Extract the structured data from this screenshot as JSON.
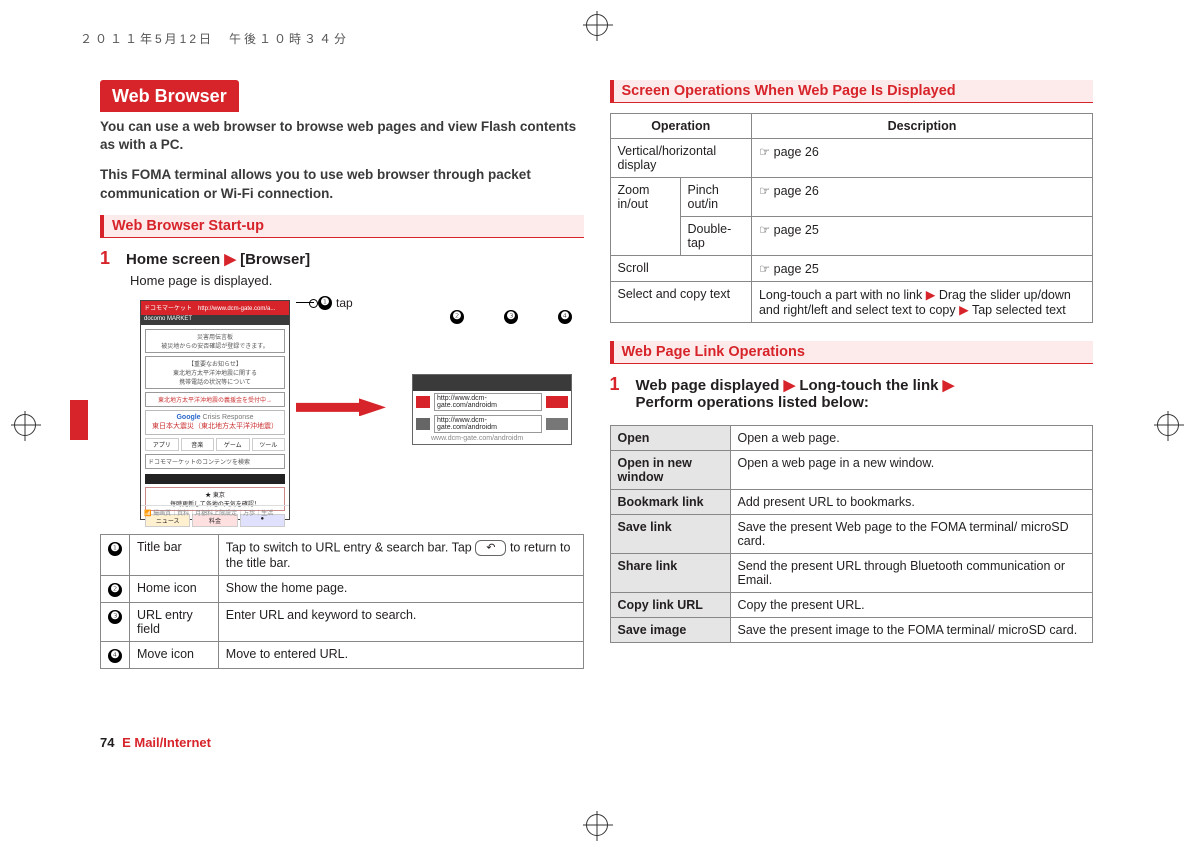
{
  "timestamp": "２０１１年5月12日　午後１０時３４分",
  "left": {
    "heading": "Web Browser",
    "intro1": "You can use a web browser to browse web pages and view Flash contents as with a PC.",
    "intro2": "This FOMA terminal allows you to use web browser through packet communication or Wi-Fi connection.",
    "sub1": "Web Browser Start-up",
    "step1_num": "1",
    "step1_a": "Home screen",
    "step1_b": "[Browser]",
    "step1_desc": "Home page is displayed.",
    "callout_tap": "tap",
    "tbl": [
      {
        "n": "❶",
        "name": "Title bar",
        "desc": "Tap to switch to URL entry & search bar. Tap",
        "desc2": "to return to the title bar."
      },
      {
        "n": "❷",
        "name": "Home icon",
        "desc": "Show the home page."
      },
      {
        "n": "❸",
        "name": "URL entry field",
        "desc": "Enter URL and keyword to search."
      },
      {
        "n": "❹",
        "name": "Move icon",
        "desc": "Move to entered URL."
      }
    ],
    "zoom_url": "http://www.dcm-gate.com/androidm",
    "zoom_sub": "www.dcm-gate.com/androidm"
  },
  "right": {
    "sub1": "Screen Operations When Web Page Is Displayed",
    "th_op": "Operation",
    "th_desc": "Description",
    "rows": [
      {
        "op": "Vertical/horizontal display",
        "desc": "☞ page 26"
      },
      {
        "op": "Zoom in/out",
        "sub": "Pinch out/in",
        "desc": "☞ page 26"
      },
      {
        "op": "",
        "sub": "Double-tap",
        "desc": "☞ page 25"
      },
      {
        "op": "Scroll",
        "desc": "☞ page 25"
      },
      {
        "op": "Select and copy text",
        "desc": "Long-touch a part with no link ▶ Drag the slider up/down and right/left and select text to copy ▶ Tap selected text"
      }
    ],
    "sub2": "Web Page Link Operations",
    "step1_num": "1",
    "step1_a": "Web page displayed",
    "step1_b": "Long-touch the link",
    "step1_c": "Perform operations listed below:",
    "tbl3": [
      {
        "k": "Open",
        "v": "Open a web page."
      },
      {
        "k": "Open in new window",
        "v": "Open a web page in a new window."
      },
      {
        "k": "Bookmark link",
        "v": "Add present URL to bookmarks."
      },
      {
        "k": "Save link",
        "v": "Save the present Web page to the FOMA terminal/ microSD card."
      },
      {
        "k": "Share link",
        "v": "Send the present URL through Bluetooth communication or Email."
      },
      {
        "k": "Copy link URL",
        "v": "Copy the present URL."
      },
      {
        "k": "Save image",
        "v": "Save the present image to the FOMA terminal/ microSD card."
      }
    ]
  },
  "footer": {
    "page": "74",
    "section": "E Mail/Internet"
  },
  "icons": {
    "n1": "❶",
    "n2": "❷",
    "n3": "❸",
    "n4": "❹",
    "back": "↶"
  }
}
